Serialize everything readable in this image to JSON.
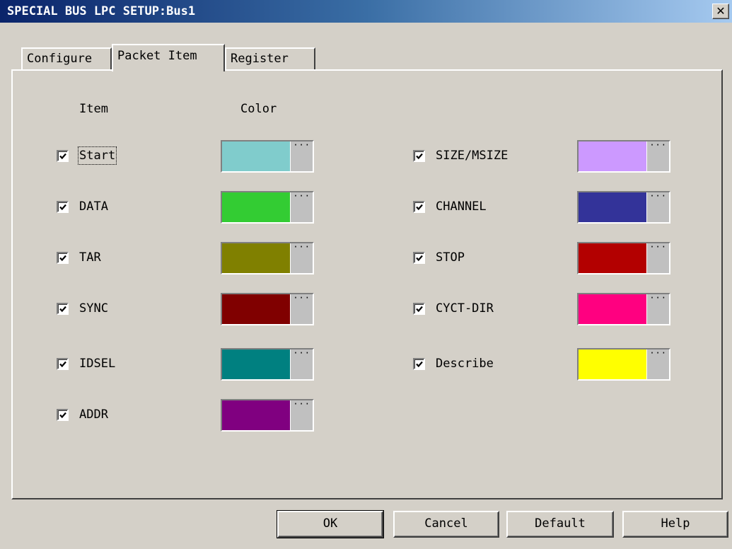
{
  "window": {
    "title": "SPECIAL BUS LPC SETUP:Bus1",
    "close_glyph": "✕"
  },
  "tabs": [
    {
      "label": "Configure",
      "active": false
    },
    {
      "label": "Packet Item",
      "active": true
    },
    {
      "label": "Register",
      "active": false
    }
  ],
  "headers": {
    "item": "Item",
    "color": "Color"
  },
  "left_items": [
    {
      "label": "Start",
      "checked": true,
      "color": "#80cccc"
    },
    {
      "label": "DATA",
      "checked": true,
      "color": "#33cc33"
    },
    {
      "label": "TAR",
      "checked": true,
      "color": "#808000"
    },
    {
      "label": "SYNC",
      "checked": true,
      "color": "#800000"
    },
    {
      "label": "IDSEL",
      "checked": true,
      "color": "#008080"
    },
    {
      "label": "ADDR",
      "checked": true,
      "color": "#800080"
    }
  ],
  "right_items": [
    {
      "label": "SIZE/MSIZE",
      "checked": true,
      "color": "#cc99ff"
    },
    {
      "label": "CHANNEL",
      "checked": true,
      "color": "#333399"
    },
    {
      "label": "STOP",
      "checked": true,
      "color": "#b30000"
    },
    {
      "label": "CYCT-DIR",
      "checked": true,
      "color": "#ff0080"
    },
    {
      "label": "Describe",
      "checked": true,
      "color": "#ffff00"
    }
  ],
  "swatch_button_glyph": "···",
  "buttons": {
    "ok": "OK",
    "cancel": "Cancel",
    "default": "Default",
    "help": "Help"
  }
}
